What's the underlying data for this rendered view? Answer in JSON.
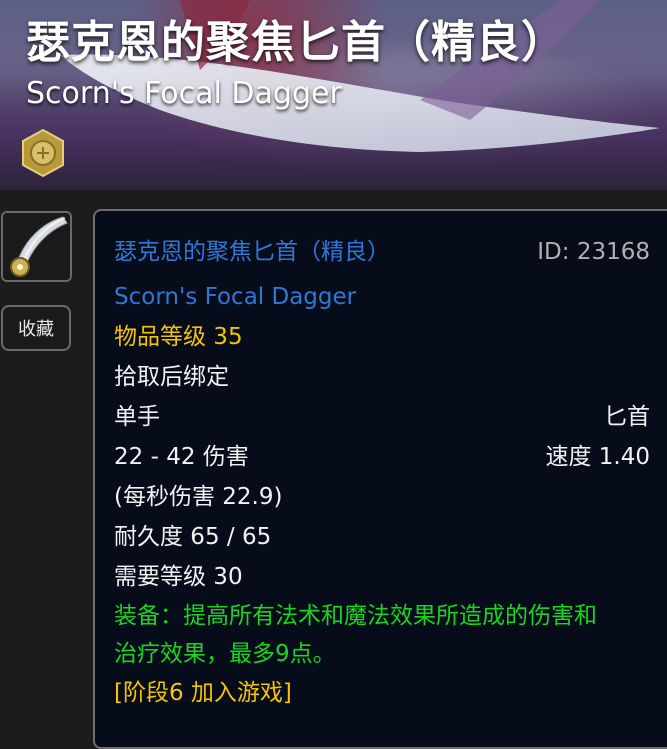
{
  "header": {
    "title_cn": "瑟克恩的聚焦匕首（精良）",
    "title_en": "Scorn's Focal Dagger"
  },
  "sidebar": {
    "favorite_label": "收藏"
  },
  "tooltip": {
    "name_cn": "瑟克恩的聚焦匕首（精良）",
    "item_id": "ID: 23168",
    "name_en": "Scorn's Focal Dagger",
    "item_level": "物品等级 35",
    "bind": "拾取后绑定",
    "slot": "单手",
    "weapon_type": "匕首",
    "damage": "22 - 42 伤害",
    "speed": "速度 1.40",
    "dps": "(每秒伤害 22.9)",
    "durability": "耐久度 65 / 65",
    "required_level": "需要等级 30",
    "equip_line1": "装备：提高所有法术和魔法效果所造成的伤害和",
    "equip_line2": "治疗效果，最多9点。",
    "phase": "[阶段6 加入游戏]"
  },
  "colors": {
    "quality_blue": "#2f78d6",
    "item_level_gold": "#f5c400",
    "equip_green": "#19d61d",
    "tooltip_bg": "#060c1a"
  },
  "icons": {
    "medal": "medal-icon",
    "item": "dagger-icon"
  }
}
